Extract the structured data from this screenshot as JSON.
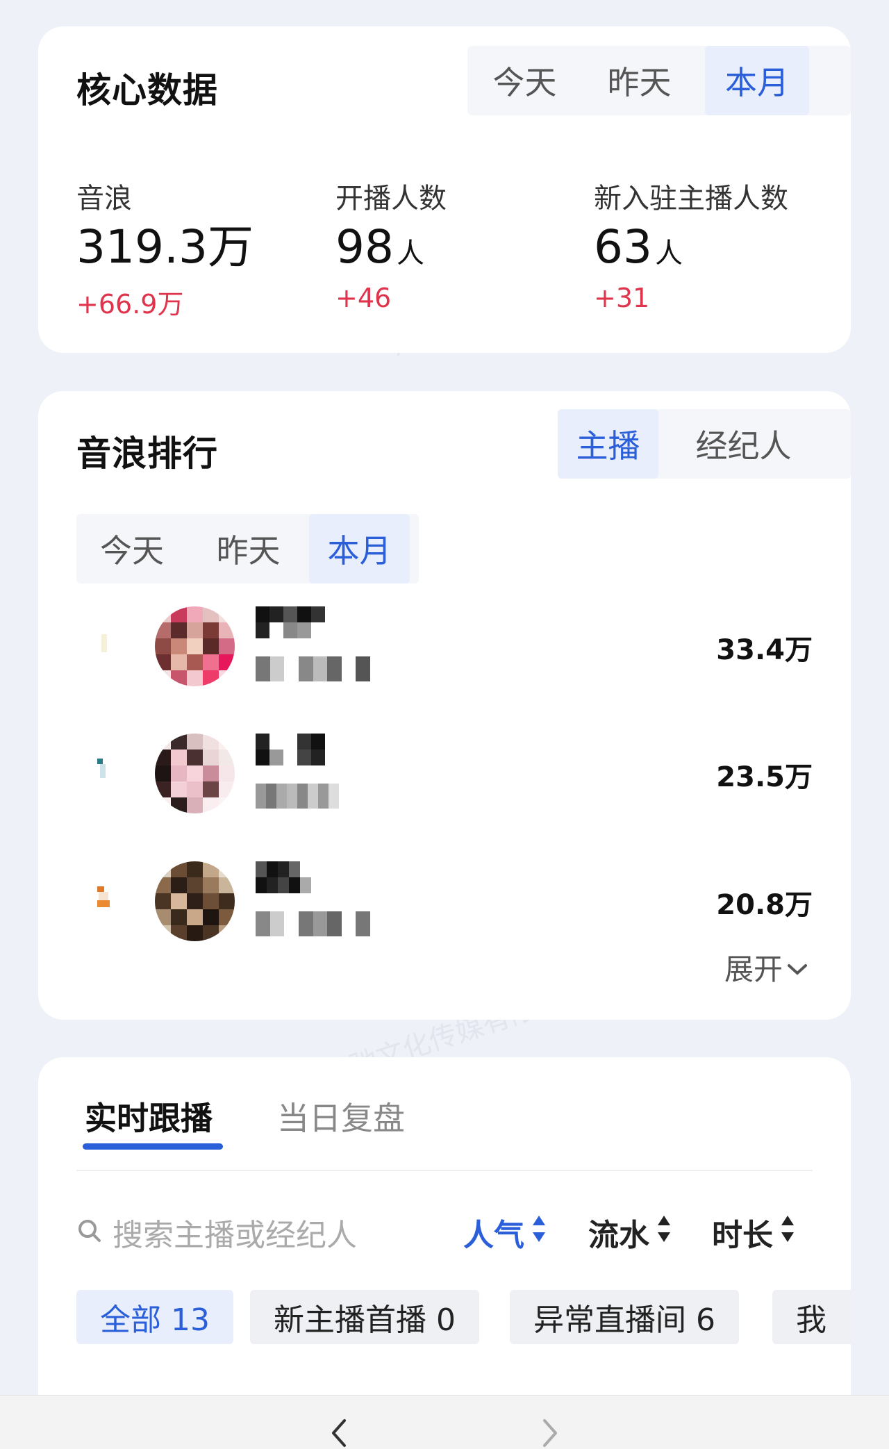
{
  "core": {
    "title": "核心数据",
    "tabs": [
      "今天",
      "昨天",
      "本月"
    ],
    "active_tab": 2,
    "stats": [
      {
        "label": "音浪",
        "value": "319.3万",
        "unit": "",
        "delta": "+66.9万"
      },
      {
        "label": "开播人数",
        "value": "98",
        "unit": "人",
        "delta": "+46"
      },
      {
        "label": "新入驻主播人数",
        "value": "63",
        "unit": "人",
        "delta": "+31"
      }
    ]
  },
  "ranking": {
    "title": "音浪排行",
    "type_tabs": [
      "主播",
      "经纪人"
    ],
    "active_type": 0,
    "period_tabs": [
      "今天",
      "昨天",
      "本月"
    ],
    "active_period": 2,
    "rows": [
      {
        "value": "33.4万"
      },
      {
        "value": "23.5万"
      },
      {
        "value": "20.8万"
      }
    ],
    "expand_label": "展开"
  },
  "live": {
    "tabs": [
      "实时跟播",
      "当日复盘"
    ],
    "active_tab": 0,
    "search_placeholder": "搜索主播或经纪人",
    "sorts": [
      "人气",
      "流水",
      "时长"
    ],
    "active_sort": 0,
    "chips": [
      {
        "label": "全部 13"
      },
      {
        "label": "新主播首播 0"
      },
      {
        "label": "异常直播间 6"
      },
      {
        "label": "我"
      }
    ],
    "active_chip": 0
  },
  "watermark_text": "河南月渡星驰文化传媒有限公司",
  "colors": {
    "accent": "#2b5fd9",
    "delta": "#e0344d"
  }
}
